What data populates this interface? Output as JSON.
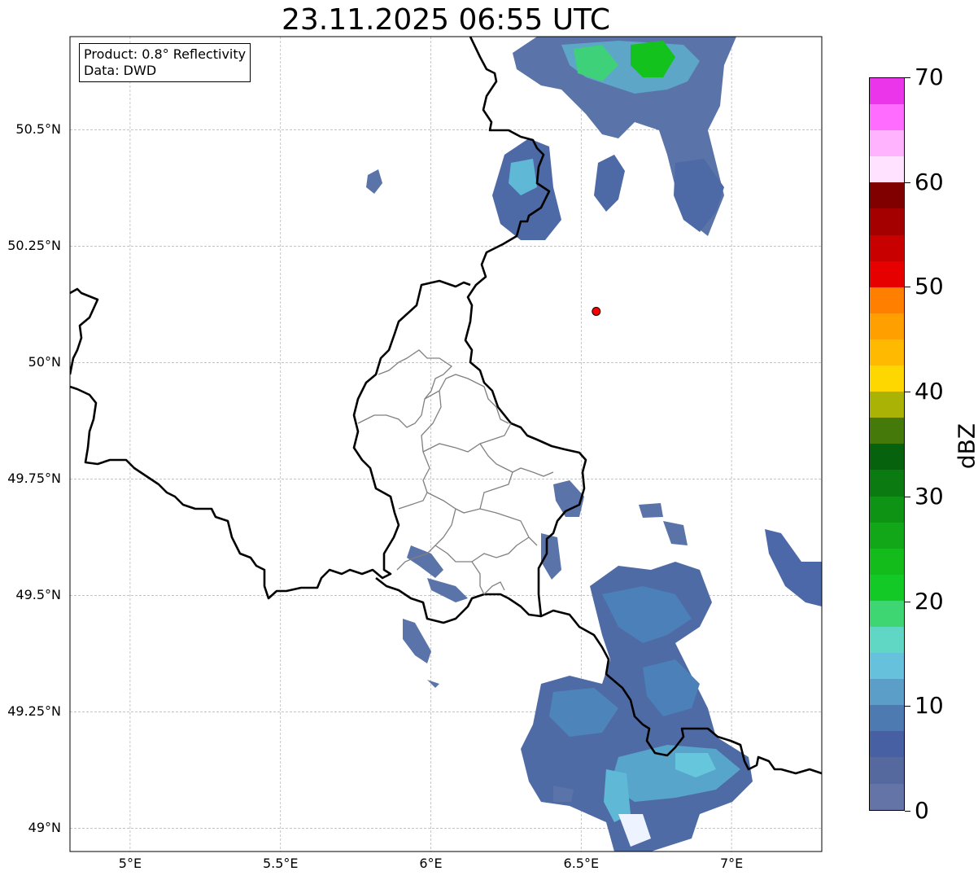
{
  "title": "23.11.2025 06:55 UTC",
  "info": {
    "product_line": "Product: 0.8° Reflectivity",
    "data_line": "Data: DWD"
  },
  "map": {
    "lon_range": [
      4.8,
      7.3
    ],
    "lat_range": [
      48.95,
      50.7
    ],
    "lat_ticks": [
      {
        "value": 49.0,
        "label": "49°N"
      },
      {
        "value": 49.25,
        "label": "49.25°N"
      },
      {
        "value": 49.5,
        "label": "49.5°N"
      },
      {
        "value": 49.75,
        "label": "49.75°N"
      },
      {
        "value": 50.0,
        "label": "50°N"
      },
      {
        "value": 50.25,
        "label": "50.25°N"
      },
      {
        "value": 50.5,
        "label": "50.5°N"
      }
    ],
    "lon_ticks": [
      {
        "value": 5.0,
        "label": "5°E"
      },
      {
        "value": 5.5,
        "label": "5.5°E"
      },
      {
        "value": 6.0,
        "label": "6°E"
      },
      {
        "value": 6.5,
        "label": "6.5°E"
      },
      {
        "value": 7.0,
        "label": "7°E"
      }
    ],
    "radar_site": {
      "lon": 6.55,
      "lat": 50.11,
      "color": "#ff0000"
    },
    "gridlines": true
  },
  "colorbar": {
    "label": "dBZ",
    "min": 0,
    "max": 70,
    "ticks": [
      {
        "value": 0,
        "label": "0"
      },
      {
        "value": 10,
        "label": "10"
      },
      {
        "value": 20,
        "label": "20"
      },
      {
        "value": 30,
        "label": "30"
      },
      {
        "value": 40,
        "label": "40"
      },
      {
        "value": 50,
        "label": "50"
      },
      {
        "value": 60,
        "label": "60"
      },
      {
        "value": 70,
        "label": "70"
      }
    ],
    "colors": [
      "#6574a6",
      "#55699f",
      "#4660a3",
      "#4c7ab1",
      "#5b9ec8",
      "#66c2dc",
      "#60d6c4",
      "#3ed673",
      "#12c926",
      "#13bb1b",
      "#12a718",
      "#0f9315",
      "#0b7a10",
      "#07620d",
      "#457a0b",
      "#abb206",
      "#ffd700",
      "#ffb900",
      "#ff9f00",
      "#ff7f00",
      "#e60000",
      "#c80000",
      "#a40000",
      "#800000",
      "#ffe2ff",
      "#ffb3ff",
      "#ff6cff",
      "#eb35eb"
    ]
  }
}
